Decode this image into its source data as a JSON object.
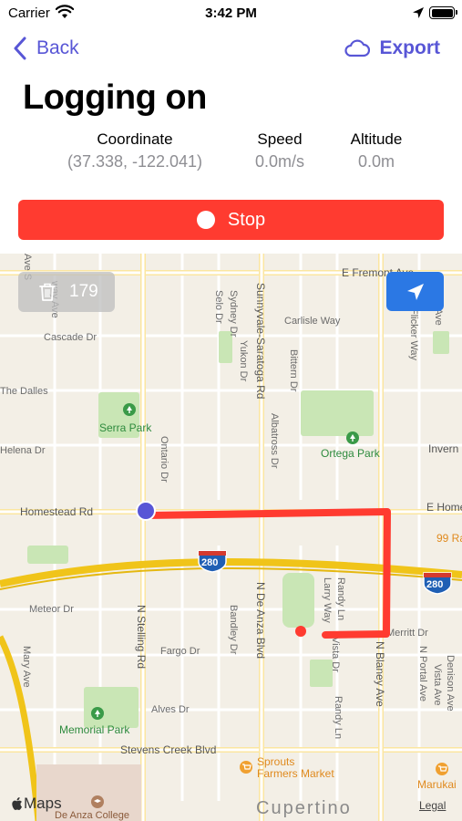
{
  "status_bar": {
    "carrier": "Carrier",
    "time": "3:42 PM",
    "icons": [
      "wifi-icon",
      "location-arrow-icon",
      "battery-icon"
    ]
  },
  "nav": {
    "back_label": "Back",
    "export_label": "Export",
    "icons": [
      "chevron-left-icon",
      "cloud-icon"
    ]
  },
  "title": "Logging on",
  "metrics": {
    "coordinate": {
      "label": "Coordinate",
      "value": "(37.338, -122.041)"
    },
    "speed": {
      "label": "Speed",
      "value": "0.0m/s"
    },
    "altitude": {
      "label": "Altitude",
      "value": "0.0m"
    }
  },
  "stop_button": {
    "label": "Stop"
  },
  "map": {
    "point_count": "179",
    "streets": {
      "e_fremont": "E Fremont Ave",
      "cascade": "Cascade Dr",
      "the_dalles": "The Dalles",
      "helena": "Helena Dr",
      "homestead": "Homestead Rd",
      "e_home": "E Home",
      "carlisle": "Carlisle Way",
      "inverness": "Invern",
      "meteor": "Meteor Dr",
      "fargo": "Fargo Dr",
      "alves": "Alves Dr",
      "stevens_creek": "Stevens Creek Blvd",
      "merritt": "Merritt Dr",
      "n_stelling": "N Stelling Rd",
      "n_de_anza": "N De Anza Blvd",
      "sunnyvale_saratoga": "Sunnyvale-Saratoga Rd",
      "n_blaney": "N Blaney Ave",
      "ontario": "Ontario Dr",
      "selo": "Selo Dr",
      "sydney": "Sydney Dr",
      "yukon": "Yukon Dr",
      "bittern": "Bittern Dr",
      "albatross": "Albatross Dr",
      "bandley": "Bandley Dr",
      "larry": "Larry Way",
      "randy": "Randy Ln",
      "vista": "Vista Dr",
      "mary": "Mary Ave",
      "flicker": "Flicker Way",
      "n_portal": "N Portal Ave",
      "denison": "Denison Ave",
      "vista_ave": "Vista Ave",
      "interstate_number": "280",
      "road_99": "99 Ra",
      "ave_s": "Ave S",
      "way": "way Ave",
      "ave_top": "Ave"
    },
    "parks": {
      "serra": "Serra Park",
      "ortega": "Ortega Park",
      "memorial": "Memorial Park"
    },
    "pois": {
      "sprouts": "Sprouts Farmers Market",
      "sprouts_line1": "Sprouts",
      "sprouts_line2": "Farmers Market",
      "marukai": "Marukai",
      "de_anza_college": "De Anza College"
    },
    "city": "Cupertino",
    "attribution": "Maps",
    "legal": "Legal",
    "colors": {
      "route": "#ff3b30",
      "interstate": "#f0c419",
      "user_location": "#5856d6",
      "park": "#c9e6b5"
    }
  },
  "colors": {
    "accent": "#5856d6",
    "stop": "#ff3b30",
    "locate": "#2b78e4"
  }
}
